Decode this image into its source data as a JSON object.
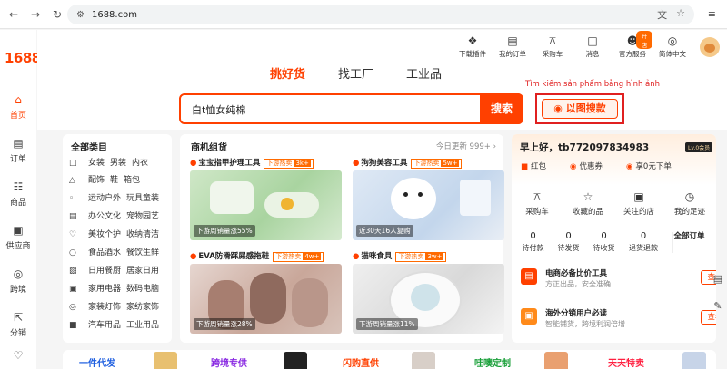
{
  "browser": {
    "url": "1688.com"
  },
  "sidebar": {
    "logo": "1688",
    "items": [
      {
        "label": "首页",
        "icon": "home-icon",
        "active": true
      },
      {
        "label": "订单",
        "icon": "clipboard-icon",
        "active": false
      },
      {
        "label": "商品",
        "icon": "grid-icon",
        "active": false
      },
      {
        "label": "供应商",
        "icon": "shop-icon",
        "active": false
      },
      {
        "label": "跨境",
        "icon": "globe-icon",
        "active": false
      },
      {
        "label": "分销",
        "icon": "share-icon",
        "active": false
      }
    ]
  },
  "topnav": [
    {
      "label": "下载插件",
      "icon": "puzzle-icon"
    },
    {
      "label": "我的订单",
      "icon": "clipboard-icon"
    },
    {
      "label": "采购车",
      "icon": "cart-icon"
    },
    {
      "label": "消息",
      "icon": "message-icon"
    },
    {
      "label": "官方服务",
      "icon": "person-icon",
      "badge": "开店"
    },
    {
      "label": "简体中文",
      "icon": "globe-icon"
    }
  ],
  "tabs": [
    {
      "label": "挑好货",
      "active": true
    },
    {
      "label": "找工厂",
      "active": false
    },
    {
      "label": "工业品",
      "active": false
    }
  ],
  "search": {
    "query": "白t恤女纯棉",
    "button": "搜索",
    "image_search_hint": "Tìm kiếm sản phẩm bằng hình ảnh",
    "image_search_button": "以图搜款"
  },
  "categories": {
    "title": "全部类目",
    "rows": [
      {
        "icon": "shirt-icon",
        "items": [
          "女装",
          "男装",
          "内衣"
        ]
      },
      {
        "icon": "bag-icon",
        "items": [
          "配饰",
          "鞋",
          "箱包"
        ]
      },
      {
        "icon": "sport-icon",
        "items": [
          "运动户外",
          "玩具童装"
        ]
      },
      {
        "icon": "office-icon",
        "items": [
          "办公文化",
          "宠物园艺"
        ]
      },
      {
        "icon": "beauty-icon",
        "items": [
          "美妆个护",
          "收纳清洁"
        ]
      },
      {
        "icon": "food-icon",
        "items": [
          "食品酒水",
          "餐饮生鲜"
        ]
      },
      {
        "icon": "daily-icon",
        "items": [
          "日用餐厨",
          "居家日用"
        ]
      },
      {
        "icon": "appliance-icon",
        "items": [
          "家用电器",
          "数码电脑"
        ]
      },
      {
        "icon": "lamp-icon",
        "items": [
          "家装灯饰",
          "家纺家饰"
        ]
      },
      {
        "icon": "car-icon",
        "items": [
          "汽车用品",
          "工业用品"
        ]
      }
    ]
  },
  "products": {
    "title": "商机组货",
    "update": "今日更新 999+",
    "items": [
      {
        "name": "宝宝指甲护理工具",
        "hot": "下游热卖",
        "hot_count": "3k+",
        "sales": "下游周销量涨55%"
      },
      {
        "name": "狗狗美容工具",
        "hot": "下游热卖",
        "hot_count": "5w+",
        "sales": "近30天16人复购"
      },
      {
        "name": "EVA防滑踩屎感拖鞋",
        "hot": "下游热卖",
        "hot_count": "4w+",
        "sales": "下游周销量涨28%"
      },
      {
        "name": "猫咪食具",
        "hot": "下游热卖",
        "hot_count": "3w+",
        "sales": "下游周销量涨11%"
      }
    ]
  },
  "user": {
    "greeting": "早上好，tb772097834983",
    "vip": "Lv.0会员",
    "assets": [
      {
        "icon": "redpacket-icon",
        "label": "红包"
      },
      {
        "icon": "coupon-icon",
        "label": "优惠券"
      },
      {
        "icon": "discount-icon",
        "label": "享0元下单"
      }
    ],
    "quick": [
      {
        "icon": "cart-icon",
        "label": "采购车"
      },
      {
        "icon": "star-icon",
        "label": "收藏的品"
      },
      {
        "icon": "store-icon",
        "label": "关注的店"
      },
      {
        "icon": "footprint-icon",
        "label": "我的足迹"
      }
    ],
    "orders": [
      {
        "count": "0",
        "label": "待付款"
      },
      {
        "count": "0",
        "label": "待发货"
      },
      {
        "count": "0",
        "label": "待收货"
      },
      {
        "count": "0",
        "label": "退货退款"
      }
    ],
    "orders_all": "全部订单",
    "tools": [
      {
        "name": "电商必备比价工具",
        "desc": "方正出品，安全准确",
        "action": "查看"
      },
      {
        "name": "海外分销用户必读",
        "desc": "智能铺货，跨境利润倍增",
        "action": "查看"
      }
    ]
  },
  "bottom": [
    {
      "label": "一件代发",
      "color": "#2060e0"
    },
    {
      "label": "跨境专供",
      "color": "#8a2be2"
    },
    {
      "label": "闪购直供",
      "color": "#ff4000"
    },
    {
      "label": "哇噢定制",
      "color": "#1aa03a"
    },
    {
      "label": "天天特卖",
      "color": "#ff2040"
    }
  ]
}
